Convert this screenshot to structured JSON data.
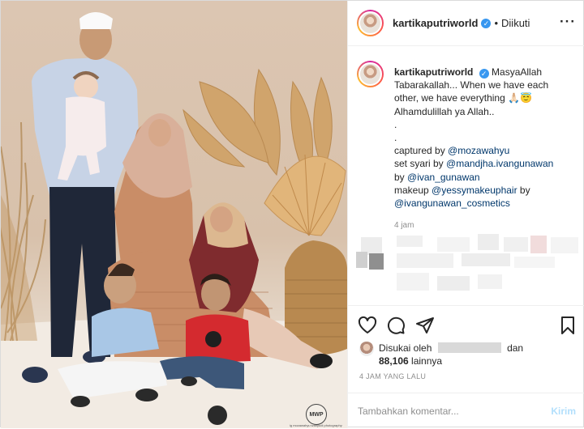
{
  "post": {
    "username": "kartikaputriworld",
    "follow_separator": "•",
    "follow_label": "Diikuti",
    "more_icon": "more-horizontal-icon",
    "verified_icon": "verified-badge-icon"
  },
  "photo": {
    "watermark": "MWP",
    "watermark_caption": "ig mozawahyu wahyudi photography"
  },
  "caption": {
    "username": "kartikaputriworld",
    "lines": [
      "MasyaAllah",
      "Tabarakallah... When we have each",
      "other, we have everything 🙏🏻😇",
      "Alhamdulillah ya Allah..",
      ".",
      "."
    ],
    "credits": [
      {
        "prefix": "captured by ",
        "mention": "@mozawahyu"
      },
      {
        "prefix": "set syari by ",
        "mention": "@mandjha.ivangunawan"
      },
      {
        "prefix": "by ",
        "mention": "@ivan_gunawan"
      },
      {
        "prefix": "makeup ",
        "mention": "@yessymakeuphair",
        "suffix": " by"
      },
      {
        "prefix": "",
        "mention": "@ivangunawan_cosmetics"
      }
    ],
    "time": "4 jam"
  },
  "actions": {
    "like_icon": "heart-icon",
    "comment_icon": "comment-icon",
    "share_icon": "share-icon",
    "save_icon": "bookmark-icon"
  },
  "likes": {
    "prefix": "Disukai oleh",
    "suffix": "dan",
    "count": "88,106",
    "count_suffix": "lainnya"
  },
  "timestamp": "4 JAM YANG LALU",
  "comment": {
    "placeholder": "Tambahkan komentar...",
    "send_label": "Kirim"
  }
}
